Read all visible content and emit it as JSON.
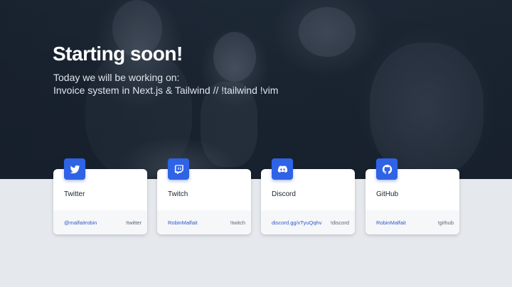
{
  "hero": {
    "title": "Starting soon!",
    "subtitle_line1": "Today we will be working on:",
    "subtitle_line2": "Invoice system in Next.js & Tailwind // !tailwind !vim"
  },
  "cards": [
    {
      "name": "Twitter",
      "handle": "@malfaitrobin",
      "command": "!twitter",
      "icon": "twitter-icon"
    },
    {
      "name": "Twitch",
      "handle": "RobinMalfait",
      "command": "!twitch",
      "icon": "twitch-icon"
    },
    {
      "name": "Discord",
      "handle": "discord.gg/vTyuQqhv",
      "command": "!discord",
      "icon": "discord-icon"
    },
    {
      "name": "GitHub",
      "handle": "RobinMalfait",
      "command": "!github",
      "icon": "github-icon"
    }
  ],
  "colors": {
    "accent": "#2f63e6",
    "hero_background": "#1f2a38",
    "page_background": "#e5e8ec",
    "link": "#2f58c9"
  }
}
